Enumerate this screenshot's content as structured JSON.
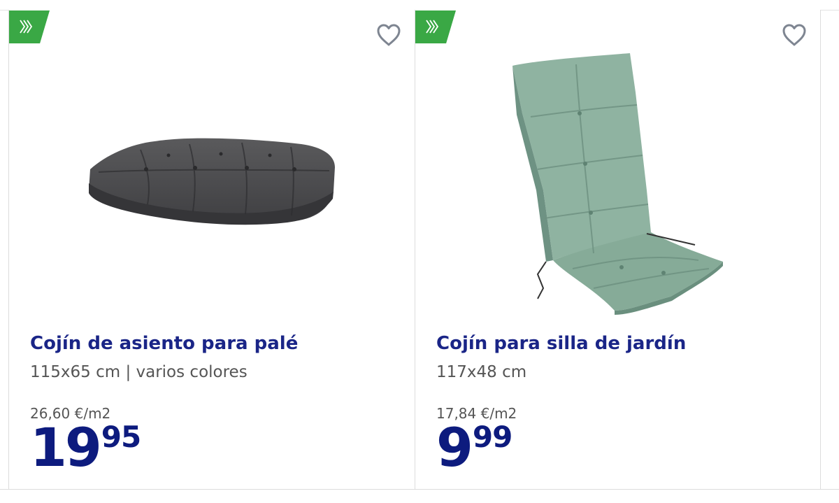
{
  "colors": {
    "title": "#1a2587",
    "price": "#0d1b7e",
    "badge": "#3aa845",
    "muted_text": "#555555",
    "border": "#dcdcdc"
  },
  "icons": {
    "badge": "chevrons-right-icon",
    "favorite": "heart-outline-icon"
  },
  "products": [
    {
      "title": "Cojín de asiento para palé",
      "subtitle": "115x65 cm | varios colores",
      "unit_price": "26,60 €/m2",
      "price_int": "19",
      "price_dec": "95",
      "image": "grey-tufted-pallet-cushion"
    },
    {
      "title": "Cojín para silla de jardín",
      "subtitle": "117x48 cm",
      "unit_price": "17,84 €/m2",
      "price_int": "9",
      "price_dec": "99",
      "image": "green-leaf-pattern-chair-cushion"
    }
  ]
}
